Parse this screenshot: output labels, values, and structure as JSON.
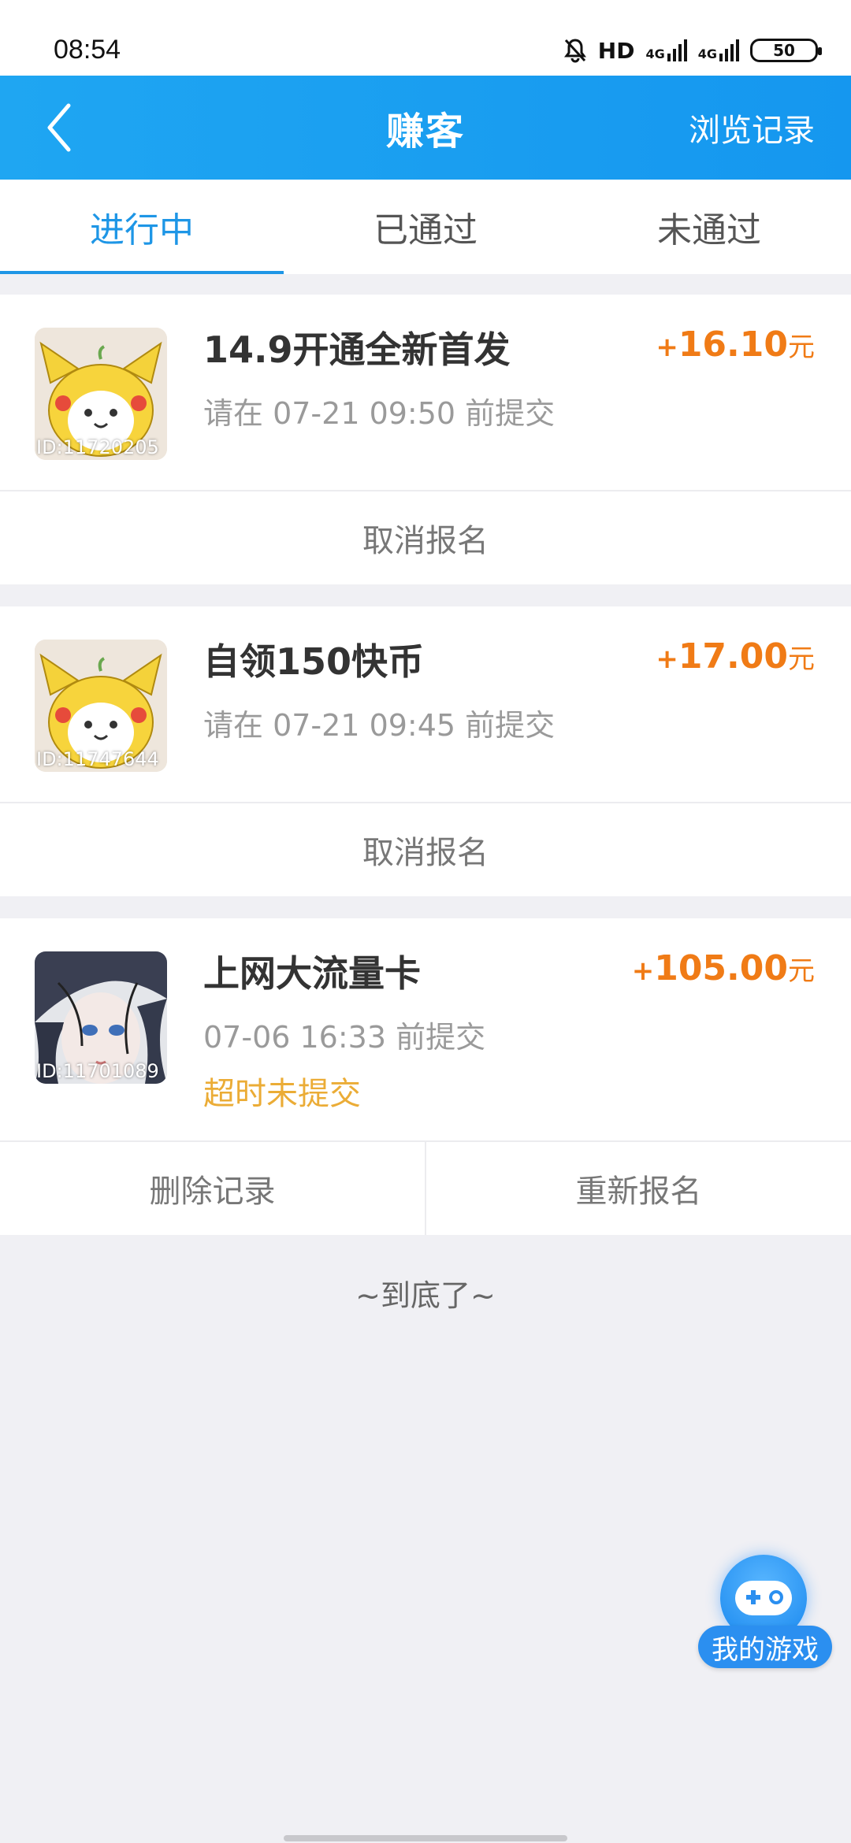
{
  "status_bar": {
    "time": "08:54",
    "hd_label": "HD",
    "net1": "4G",
    "net2": "4G",
    "battery": "50"
  },
  "header": {
    "title": "赚客",
    "right_link": "浏览记录",
    "back_icon": "chevron-left-icon",
    "color": "#1a9cf0"
  },
  "tabs": [
    {
      "label": "进行中",
      "active": true
    },
    {
      "label": "已通过",
      "active": false
    },
    {
      "label": "未通过",
      "active": false
    }
  ],
  "tasks": [
    {
      "title": "14.9开通全新首发",
      "subtitle": "请在 07-21 09:50 前提交",
      "reward_plus": "+",
      "reward_amount": "16.10",
      "reward_unit": "元",
      "avatar_id": "ID:11720205",
      "actions": [
        "取消报名"
      ]
    },
    {
      "title": "自领150快币",
      "subtitle": "请在 07-21 09:45 前提交",
      "reward_plus": "+",
      "reward_amount": "17.00",
      "reward_unit": "元",
      "avatar_id": "ID:11747644",
      "actions": [
        "取消报名"
      ]
    },
    {
      "title": "上网大流量卡",
      "subtitle": "07-06 16:33 前提交",
      "status": "超时未提交",
      "reward_plus": "+",
      "reward_amount": "105.00",
      "reward_unit": "元",
      "avatar_id": "ID:11701089",
      "actions": [
        "删除记录",
        "重新报名"
      ]
    }
  ],
  "end_text": "~到底了~",
  "fab": {
    "label": "我的游戏",
    "icon": "gamepad-icon"
  },
  "colors": {
    "accent": "#1e96e6",
    "reward": "#f07b16",
    "warning": "#ebac36"
  }
}
